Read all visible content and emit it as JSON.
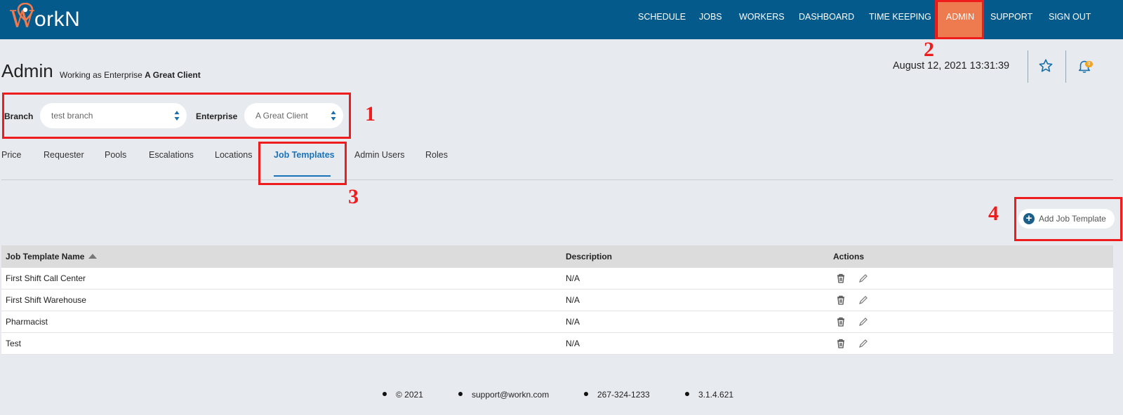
{
  "app": {
    "logo_text": "orkN",
    "logo_w": "W"
  },
  "nav": {
    "items": [
      "SCHEDULE",
      "JOBS",
      "WORKERS",
      "DASHBOARD",
      "TIME KEEPING",
      "ADMIN",
      "SUPPORT",
      "SIGN OUT"
    ],
    "active": "ADMIN"
  },
  "header": {
    "title": "Admin",
    "subtitle_prefix": "Working as Enterprise",
    "subtitle_enterprise": "A Great Client",
    "datetime": "August 12, 2021 13:31:39",
    "notification_count": "0"
  },
  "filters": {
    "branch_label": "Branch",
    "branch_value": "test branch",
    "enterprise_label": "Enterprise",
    "enterprise_value": "A Great Client"
  },
  "tabs": [
    "Price",
    "Requester",
    "Pools",
    "Escalations",
    "Locations",
    "Job Templates",
    "Admin Users",
    "Roles"
  ],
  "active_tab": "Job Templates",
  "add_button": "Add Job Template",
  "table": {
    "headers": [
      "Job Template Name",
      "Description",
      "Actions"
    ],
    "rows": [
      {
        "name": "First Shift Call Center",
        "description": "N/A"
      },
      {
        "name": "First Shift Warehouse",
        "description": "N/A"
      },
      {
        "name": "Pharmacist",
        "description": "N/A"
      },
      {
        "name": "Test",
        "description": "N/A"
      }
    ]
  },
  "annotations": [
    "1",
    "2",
    "3",
    "4"
  ],
  "footer": [
    "© 2021",
    "support@workn.com",
    "267-324-1233",
    "3.1.4.621"
  ],
  "colors": {
    "navbar": "#055a8c",
    "accent": "#ee7b4f",
    "link": "#1a73b8",
    "annotation": "#ee1c1c"
  },
  "icons": [
    "location-pin-icon",
    "star-icon",
    "bell-icon",
    "sort-up-icon",
    "plus-circle-icon",
    "trash-icon",
    "pencil-icon",
    "spinner-arrows-icon"
  ]
}
